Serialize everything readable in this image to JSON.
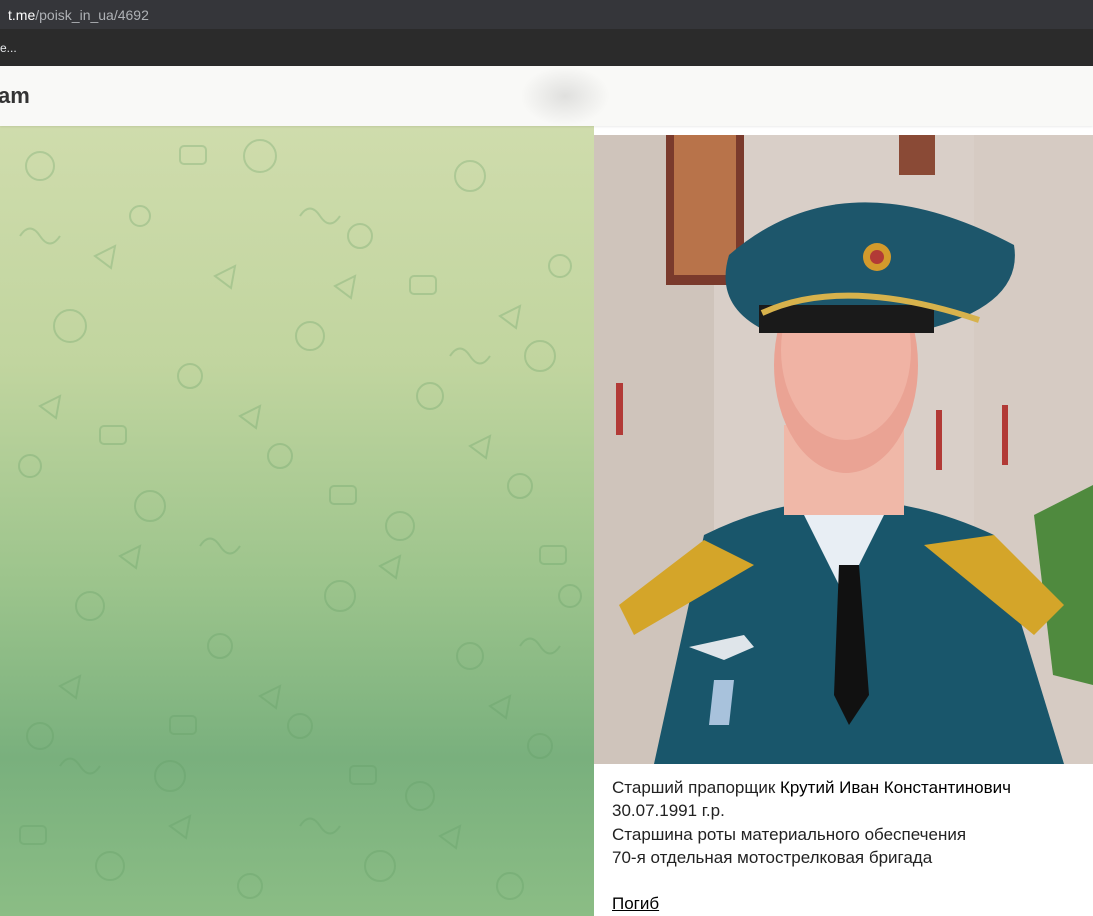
{
  "browser": {
    "url_host": "t.me",
    "url_path": "/poisk_in_ua/4692",
    "bookmark_label": "e..."
  },
  "header": {
    "brand_fragment": "am"
  },
  "post": {
    "rank": "Старший прапорщик ",
    "name": "Крутий Иван Константинович",
    "birth": "30.07.1991 г.р.",
    "position": "Старшина роты материального обеспечения",
    "unit": "70-я отдельная мотострелковая бригада",
    "status": "Погиб"
  },
  "colors": {
    "urlbar_bg": "#35363a",
    "bookmarks_bg": "#2b2b2b",
    "header_bg": "#f9f9f7",
    "chat_bg_top": "#cfdcac",
    "chat_bg_bottom": "#79b07d"
  }
}
